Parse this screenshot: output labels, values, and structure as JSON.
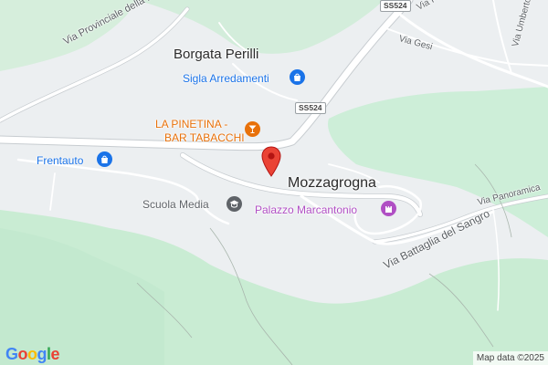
{
  "map": {
    "places": {
      "borgata": "Borgata Perilli",
      "mozzagrogna": "Mozzagrogna"
    },
    "streets": {
      "via_provinciale": "Via Provinciale della Rocca",
      "via_piane": "Via Piane",
      "via_gesi": "Via Gesi",
      "via_umberto": "Via Umberto",
      "via_panoramica": "Via Panoramica",
      "via_battaglia": "Via Battaglia del Sangro"
    },
    "road_shields": {
      "top": "SS524",
      "mid": "SS524"
    },
    "pois": {
      "sigla": {
        "label": "Sigla Arredamenti",
        "icon": "shopping-bag-icon",
        "color": "#1a73e8"
      },
      "pinetina": {
        "label_line1": "LA PINETINA -",
        "label_line2": "BAR TABACCHI",
        "icon": "cocktail-icon",
        "color": "#e8710a"
      },
      "frentauto": {
        "label": "Frentauto",
        "icon": "shopping-bag-icon",
        "color": "#1a73e8"
      },
      "scuola": {
        "label": "Scuola Media",
        "icon": "school-icon",
        "color": "#5f6368"
      },
      "palazzo": {
        "label": "Palazzo Marcantonio",
        "icon": "castle-icon",
        "color": "#b04fc4"
      }
    },
    "marker_icon": "red-location-pin-icon",
    "branding": {
      "logo": "Google",
      "attribution": "Map data ©2025"
    },
    "colors": {
      "land": "#eceff1",
      "forest": "#cdeed8",
      "road": "#ffffff",
      "road_casing": "#c7ccd0",
      "marker": "#ea4335"
    }
  }
}
